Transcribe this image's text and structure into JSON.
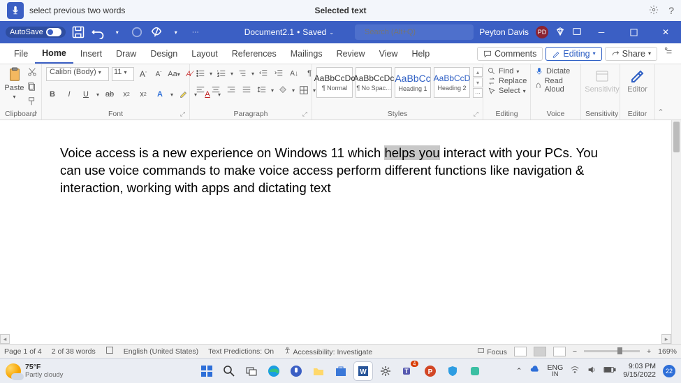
{
  "voice": {
    "command": "select previous two words",
    "feedback": "Selected text"
  },
  "titlebar": {
    "autosave_label": "AutoSave",
    "doc_name": "Document2.1",
    "doc_status": "Saved",
    "search_placeholder": "Search (Alt+Q)",
    "user_name": "Peyton Davis",
    "user_initials": "PD"
  },
  "tabs": {
    "items": [
      "File",
      "Home",
      "Insert",
      "Draw",
      "Design",
      "Layout",
      "References",
      "Mailings",
      "Review",
      "View",
      "Help"
    ],
    "active": "Home",
    "comments": "Comments",
    "editing": "Editing",
    "share": "Share"
  },
  "ribbon": {
    "clipboard": {
      "paste": "Paste",
      "label": "Clipboard"
    },
    "font": {
      "name": "Calibri (Body)",
      "size": "11",
      "label": "Font"
    },
    "paragraph": {
      "label": "Paragraph"
    },
    "styles": {
      "items": [
        {
          "preview": "AaBbCcDc",
          "name": "¶ Normal"
        },
        {
          "preview": "AaBbCcDc",
          "name": "¶ No Spac..."
        },
        {
          "preview": "AaBbCc",
          "name": "Heading 1"
        },
        {
          "preview": "AaBbCcD",
          "name": "Heading 2"
        }
      ],
      "label": "Styles"
    },
    "editing": {
      "find": "Find",
      "replace": "Replace",
      "select": "Select",
      "label": "Editing"
    },
    "voice": {
      "dictate": "Dictate",
      "read_aloud": "Read Aloud",
      "label": "Voice"
    },
    "sensitivity": {
      "btn": "Sensitivity",
      "label": "Sensitivity"
    },
    "editor": {
      "btn": "Editor",
      "label": "Editor"
    }
  },
  "document": {
    "pre": "Voice access is a new experience on Windows 11 which ",
    "selected": "helps you",
    "post": " interact with your PCs. You can use voice commands to make voice access perform different functions like navigation & interaction, working with apps and dictating text"
  },
  "status": {
    "page": "Page 1 of 4",
    "words": "2 of 38 words",
    "lang": "English (United States)",
    "predictions": "Text Predictions: On",
    "accessibility": "Accessibility: Investigate",
    "focus": "Focus",
    "zoom": "169%"
  },
  "taskbar": {
    "temp": "75°F",
    "weather": "Partly cloudy",
    "lang1": "ENG",
    "lang2": "IN",
    "time": "9:03 PM",
    "date": "9/15/2022",
    "notif_count": "22"
  }
}
